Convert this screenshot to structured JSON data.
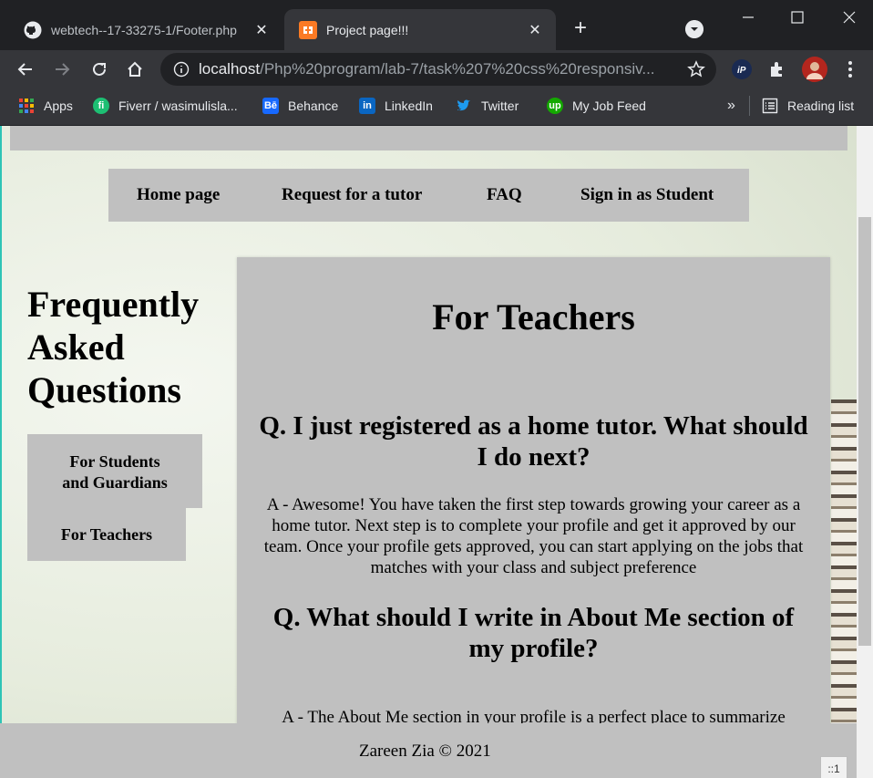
{
  "browser": {
    "tabs": [
      {
        "title": "webtech--17-33275-1/Footer.php",
        "icon": "github-icon",
        "active": false
      },
      {
        "title": "Project page!!!",
        "icon": "xampp-icon",
        "active": true
      }
    ],
    "address": {
      "host": "localhost",
      "path": "/Php%20program/lab-7/task%207%20css%20responsiv..."
    },
    "bookmarks": [
      {
        "label": "Apps",
        "icon": "apps-grid-icon"
      },
      {
        "label": "Fiverr / wasimulisla...",
        "icon": "fiverr-icon"
      },
      {
        "label": "Behance",
        "icon": "behance-icon"
      },
      {
        "label": "LinkedIn",
        "icon": "linkedin-icon"
      },
      {
        "label": "Twitter",
        "icon": "twitter-icon"
      },
      {
        "label": "My Job Feed",
        "icon": "upwork-icon"
      }
    ],
    "bookmarks_overflow": "»",
    "reading_list": "Reading list",
    "colors": {
      "tabstrip": "#202124",
      "toolbar": "#35363a",
      "text": "#e8eaed"
    }
  },
  "page": {
    "nav": [
      "Home page",
      "Request for a tutor",
      "FAQ",
      "Sign in as Student"
    ],
    "side": {
      "heading": "Frequently Asked Questions",
      "buttons": {
        "students": "For Students and Guardians",
        "teachers": "For Teachers"
      }
    },
    "content": {
      "title": "For Teachers",
      "faqs": [
        {
          "q": "Q. I just registered as a home tutor. What should I do next?",
          "a": "A - Awesome! You have taken the first step towards growing your career as a home tutor. Next step is to complete your profile and get it approved by our team. Once your profile gets approved, you can start applying on the jobs that matches with your class and subject preference"
        },
        {
          "q": "Q. What should I write in About Me section of my profile?",
          "a": "A - The About Me section in your profile is a perfect place to summarize"
        }
      ]
    },
    "footer": {
      "credit": "Zareen Zia © 2021",
      "pager": "::1"
    },
    "colors": {
      "panel": "#c0c0c0",
      "text": "#000000"
    }
  }
}
